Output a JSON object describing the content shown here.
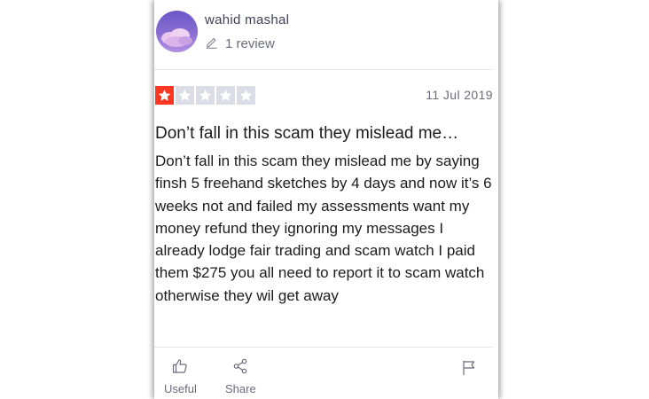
{
  "reviewer": {
    "name": "wahid mashal",
    "review_count": "1 review"
  },
  "review": {
    "rating": 1,
    "rating_max": 5,
    "date": "11 Jul 2019",
    "title": "Don’t fall in this scam they mislead me…",
    "body": "Don’t fall in this scam they mislead me by saying finsh 5 freehand sketches by 4 days and now it’s 6 weeks not and failed my assessments want my money refund they ignoring my messages I already lodge fair trading and scam watch I paid them $275 you all need to report it to scam watch otherwise they wil get away"
  },
  "actions": {
    "useful_label": "Useful",
    "share_label": "Share"
  },
  "icons": [
    "pencil-icon",
    "star-icon",
    "thumbs-up-icon",
    "share-icon",
    "flag-icon"
  ],
  "colors": {
    "star_active": "#ff3722",
    "star_inactive": "#dcdce6",
    "muted_text": "#6b6b7b",
    "body_text": "#1c1c1c"
  }
}
